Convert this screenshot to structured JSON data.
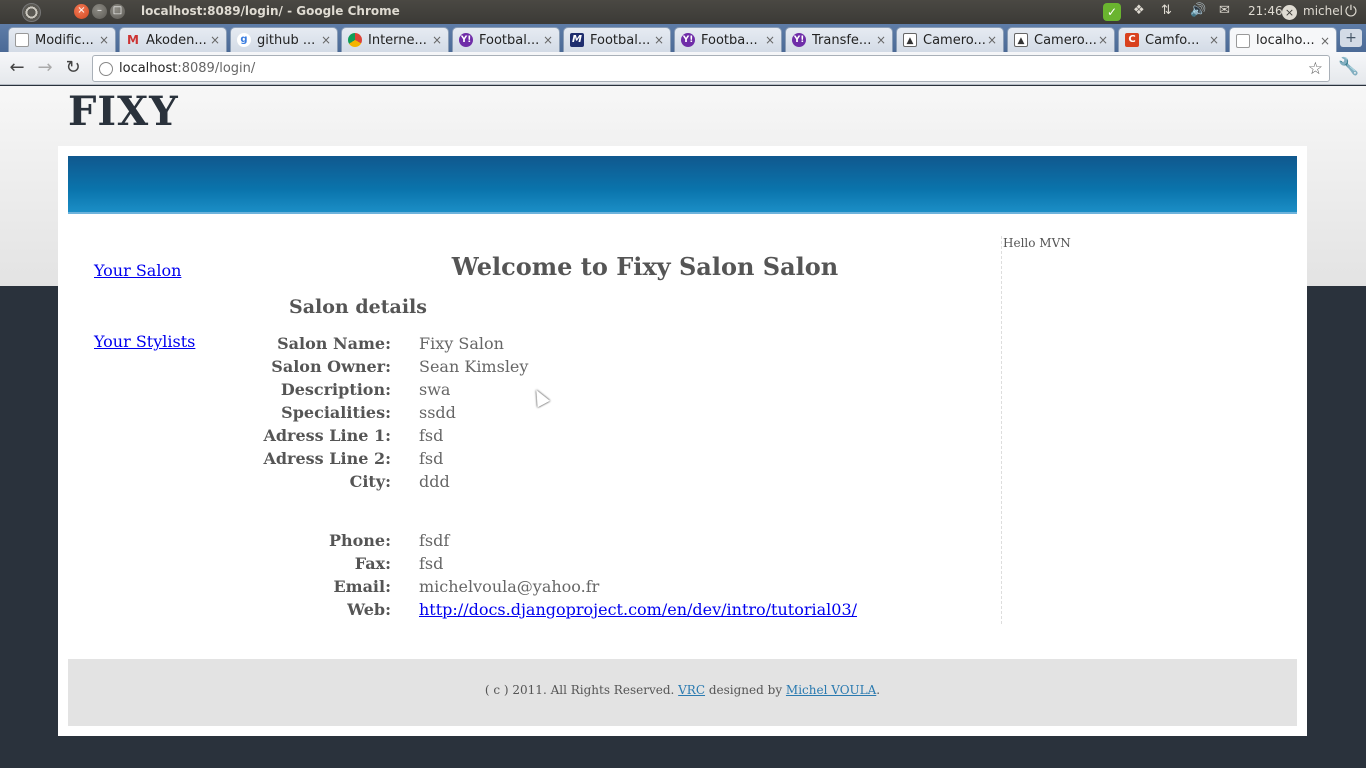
{
  "os": {
    "window_title": "localhost:8089/login/ - Google Chrome",
    "clock": "21:46",
    "user": "michel"
  },
  "tabs": [
    {
      "title": "Modific...",
      "icon": "document-icon"
    },
    {
      "title": "Akoden...",
      "icon": "gmail-icon"
    },
    {
      "title": "github ...",
      "icon": "google-icon"
    },
    {
      "title": "Interne...",
      "icon": "chrome-icon"
    },
    {
      "title": "Footbal...",
      "icon": "yahoo-icon"
    },
    {
      "title": "Footbal...",
      "icon": "m-icon"
    },
    {
      "title": "Footba...",
      "icon": "yahoo-icon"
    },
    {
      "title": "Transfe...",
      "icon": "yahoo-icon"
    },
    {
      "title": "Camero...",
      "icon": "camera-icon"
    },
    {
      "title": "Camero...",
      "icon": "camera-icon"
    },
    {
      "title": "Camfo...",
      "icon": "camfo-icon"
    },
    {
      "title": "localho...",
      "icon": "document-icon",
      "active": true
    }
  ],
  "address_bar": {
    "host": "localhost",
    "rest": ":8089/login/"
  },
  "page": {
    "logo": "FIXY",
    "sidebar": {
      "your_salon": "Your Salon",
      "your_stylists": "Your Stylists"
    },
    "heading": "Welcome to Fixy Salon Salon",
    "section": "Salon details",
    "details": [
      {
        "label": "Salon Name:",
        "value": "Fixy Salon"
      },
      {
        "label": "Salon Owner:",
        "value": "Sean Kimsley"
      },
      {
        "label": "Description:",
        "value": "swa"
      },
      {
        "label": "Specialities:",
        "value": "ssdd"
      },
      {
        "label": "Adress Line 1:",
        "value": "fsd"
      },
      {
        "label": "Adress Line 2:",
        "value": "fsd"
      },
      {
        "label": "City:",
        "value": "ddd"
      },
      {
        "label": "Phone:",
        "value": "fsdf"
      },
      {
        "label": "Fax:",
        "value": "fsd"
      },
      {
        "label": "Email:",
        "value": "michelvoula@yahoo.fr"
      },
      {
        "label": "Web:",
        "value": "http://docs.djangoproject.com/en/dev/intro/tutorial03/",
        "link": true
      }
    ],
    "greeting": "Hello MVN",
    "footer": {
      "prefix": "( c ) 2011. All Rights Reserved. ",
      "vrc": "VRC",
      "middle": " designed by ",
      "author": "Michel VOULA",
      "suffix": "."
    }
  },
  "colors": {
    "banner": "#0a74ac",
    "link": "#0000ee",
    "page_bg": "#2a323c"
  }
}
